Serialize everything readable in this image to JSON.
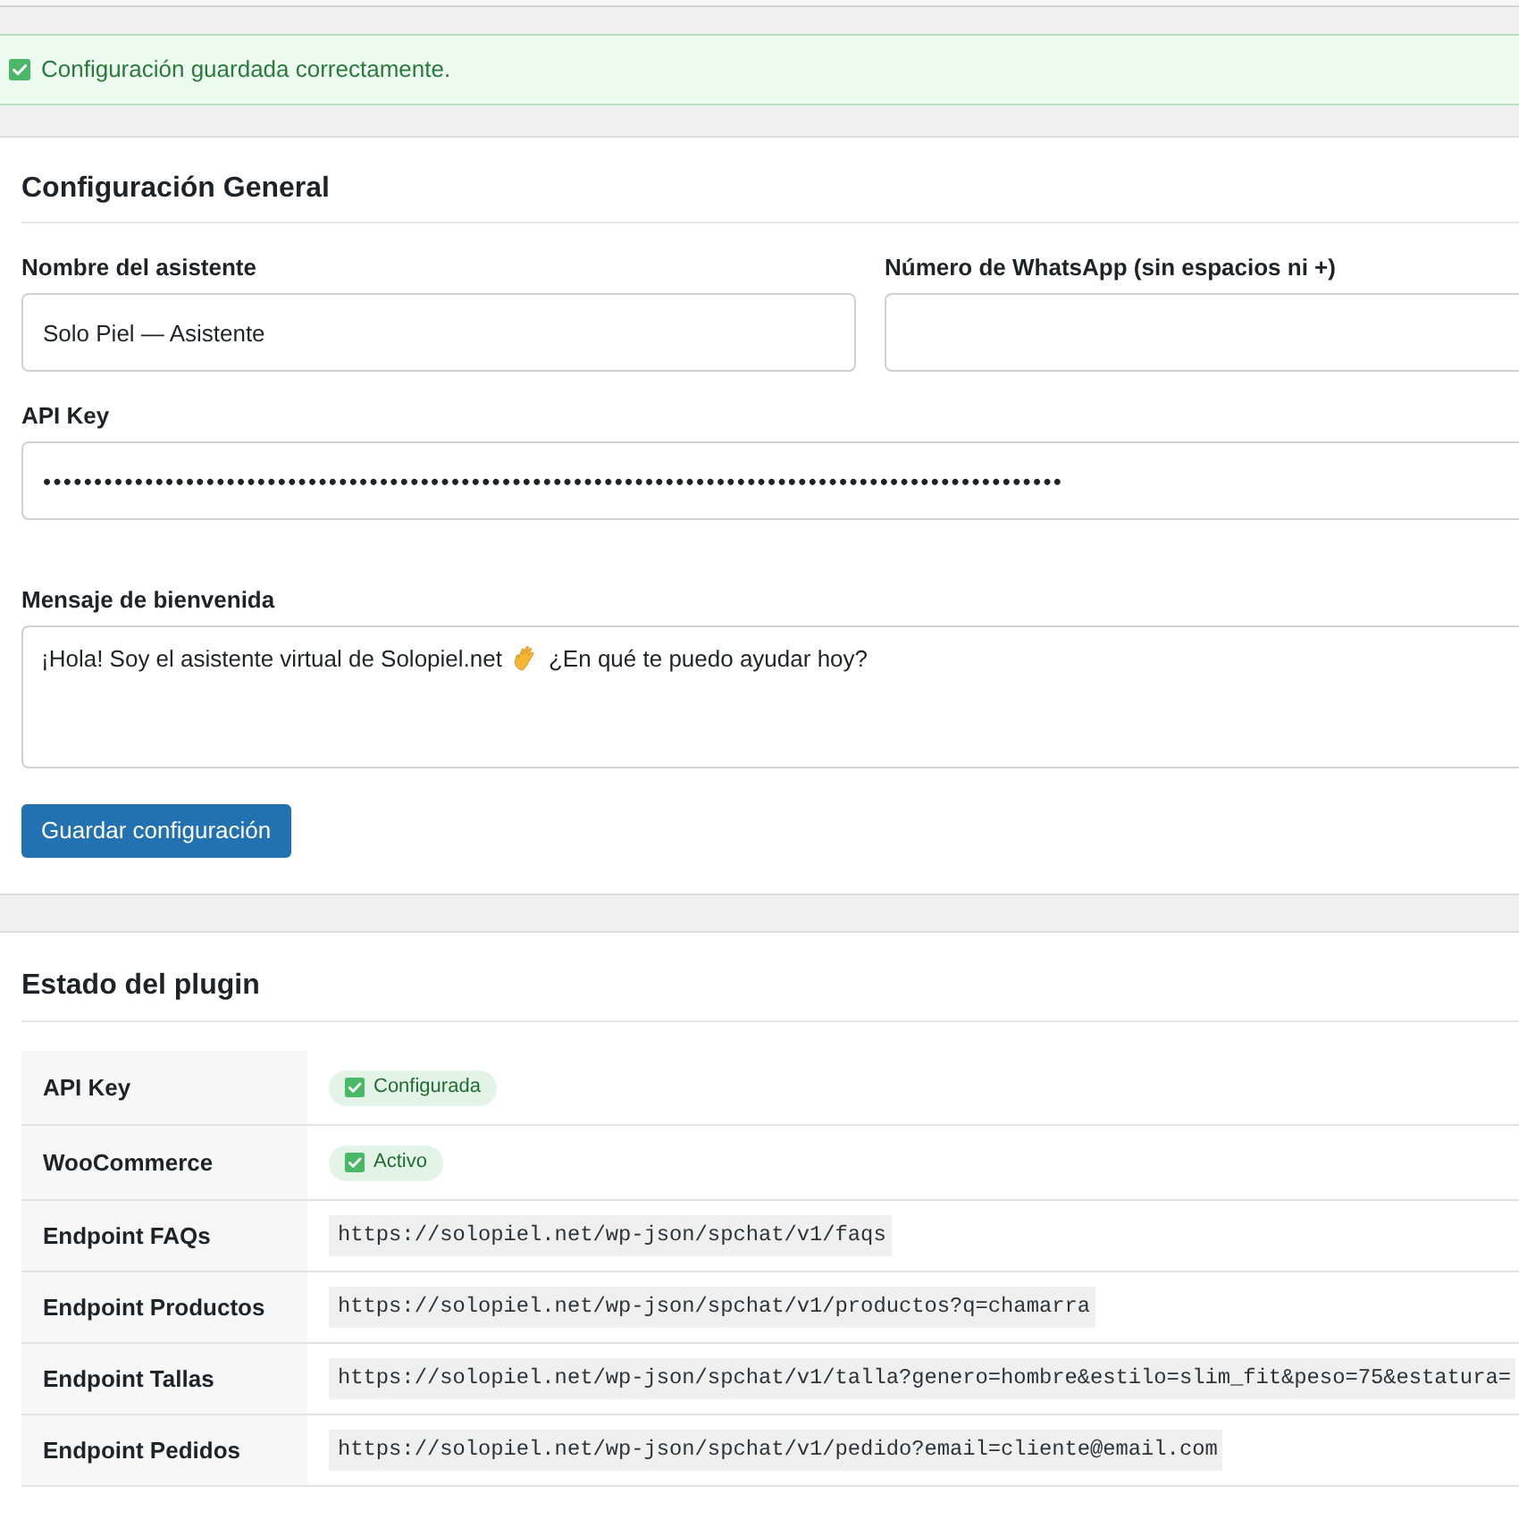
{
  "notice": {
    "kind": "success",
    "text": "Configuración guardada correctamente."
  },
  "general_settings": {
    "title": "Configuración General",
    "field_rows": [
      [
        {
          "kind": "text",
          "label": "Nombre del asistente",
          "value": "Solo Piel — Asistente"
        },
        {
          "kind": "text",
          "label": "Número de WhatsApp (sin espacios ni +)"
        }
      ],
      [
        {
          "kind": "password",
          "label": "API Key",
          "value": "••••••••••••••••••••••••••••••••••••••••••••••••••••••••••••••••••••••••••••••••••••••••••••••••••••"
        }
      ],
      [
        {
          "kind": "textarea",
          "label": "Mensaje de bienvenida",
          "value_parts": [
            {
              "kind": "text",
              "text": "¡Hola! Soy el asistente virtual de Solopiel.net"
            },
            {
              "kind": "icon"
            },
            {
              "kind": "text",
              "text": "¿En qué te puedo ayudar hoy?"
            }
          ]
        }
      ]
    ],
    "save_button": "Guardar configuración"
  },
  "plugin_status": {
    "title": "Estado del plugin",
    "rows": [
      {
        "label": "API Key",
        "kind": "badge",
        "value": "Configurada"
      },
      {
        "label": "WooCommerce",
        "kind": "badge",
        "value": "Activo"
      },
      {
        "label": "Endpoint FAQs",
        "kind": "code",
        "value": "https://solopiel.net/wp-json/spchat/v1/faqs"
      },
      {
        "label": "Endpoint Productos",
        "kind": "code",
        "value": "https://solopiel.net/wp-json/spchat/v1/productos?q=chamarra"
      },
      {
        "label": "Endpoint Tallas",
        "kind": "code",
        "value": "https://solopiel.net/wp-json/spchat/v1/talla?genero=hombre&estilo=slim_fit&peso=75&estatura="
      },
      {
        "label": "Endpoint Pedidos",
        "kind": "code",
        "value": "https://solopiel.net/wp-json/spchat/v1/pedido?email=cliente@email.com"
      }
    ]
  }
}
